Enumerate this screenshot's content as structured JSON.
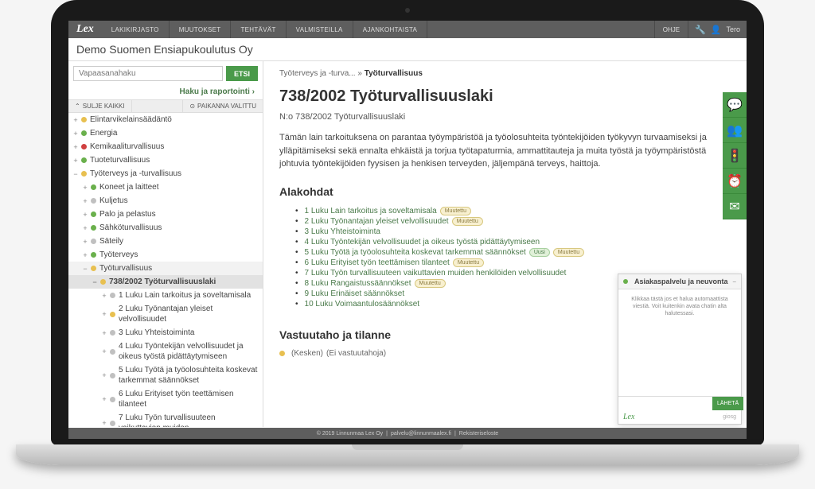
{
  "nav": {
    "logo": "Lex",
    "items": [
      "LAKIKIRJASTO",
      "MUUTOKSET",
      "TEHTÄVÄT",
      "VALMISTEILLA",
      "AJANKOHTAISTA"
    ],
    "ohje": "OHJE",
    "user": "Tero"
  },
  "company": "Demo Suomen Ensiapukoulutus Oy",
  "search": {
    "placeholder": "Vapaasanahaku",
    "button": "ETSI",
    "haku_link": "Haku ja raportointi"
  },
  "tree_ctrl": {
    "sulje": "SULJE KAIKKI",
    "paikanna": "PAIKANNA VALITTU"
  },
  "tree": {
    "elintarvike": "Elintarvikelainsäädäntö",
    "energia": "Energia",
    "kemikaali": "Kemikaaliturvallisuus",
    "tuote": "Tuoteturvallisuus",
    "tyoterveys": "Työterveys ja -turvallisuus",
    "koneet": "Koneet ja laitteet",
    "kuljetus": "Kuljetus",
    "palo": "Palo ja pelastus",
    "sahko": "Sähköturvallisuus",
    "sateily": "Säteily",
    "tyoterveys2": "Työterveys",
    "tyoturvallisuus": "Työturvallisuus",
    "law_738": "738/2002 Työturvallisuuslaki",
    "luku1": "1 Luku Lain tarkoitus ja soveltamisala",
    "luku2": "2 Luku Työnantajan yleiset velvollisuudet",
    "luku3": "3 Luku Yhteistoiminta",
    "luku4": "4 Luku Työntekijän velvollisuudet ja oikeus työstä pidättäytymiseen",
    "luku5": "5 Luku Työtä ja työolosuhteita koskevat tarkemmat säännökset",
    "luku6": "6 Luku Erityiset työn teettämisen tilanteet",
    "luku7": "7 Luku Työn turvallisuuteen vaikuttavien muiden"
  },
  "content": {
    "breadcrumb_1": "Työterveys ja -turva...",
    "breadcrumb_sep": " » ",
    "breadcrumb_2": "Työturvallisuus",
    "title": "738/2002 Työturvallisuuslaki",
    "subtitle": "N:o 738/2002 Työturvallisuuslaki",
    "body": "Tämän lain tarkoituksena on parantaa työympäristöä ja työolosuhteita työntekijöiden työkyvyn turvaamiseksi ja ylläpitämiseksi sekä ennalta ehkäistä ja torjua työtapaturmia, ammattitauteja ja muita työstä ja työympäristöstä johtuvia työntekijöiden fyysisen ja henkisen terveyden, jäljempänä terveys, haittoja.",
    "alakohdat": "Alakohdat",
    "chapters": [
      {
        "label": "1 Luku Lain tarkoitus ja soveltamisala",
        "badges": [
          "Muutettu"
        ]
      },
      {
        "label": "2 Luku Työnantajan yleiset velvollisuudet",
        "badges": [
          "Muutettu"
        ]
      },
      {
        "label": "3 Luku Yhteistoiminta",
        "badges": []
      },
      {
        "label": "4 Luku Työntekijän velvollisuudet ja oikeus työstä pidättäytymiseen",
        "badges": []
      },
      {
        "label": "5 Luku Työtä ja työolosuhteita koskevat tarkemmat säännökset",
        "badges": [
          "Uusi",
          "Muutettu"
        ]
      },
      {
        "label": "6 Luku Erityiset työn teettämisen tilanteet",
        "badges": [
          "Muutettu"
        ]
      },
      {
        "label": "7 Luku Työn turvallisuuteen vaikuttavien muiden henkilöiden velvollisuudet",
        "badges": []
      },
      {
        "label": "8 Luku Rangaistussäännökset",
        "badges": [
          "Muutettu"
        ]
      },
      {
        "label": "9 Luku Erinäiset säännökset",
        "badges": []
      },
      {
        "label": "10 Luku Voimaantulosäännökset",
        "badges": []
      }
    ],
    "vastuu_head": "Vastuutaho ja tilanne",
    "vastuu_status": "(Kesken)",
    "vastuu_note": "(Ei vastuutahoja)"
  },
  "chat": {
    "title": "Asiakaspalvelu ja neuvonta",
    "body": "Klikkaa tästä jos et halua automaattista viestiä. Voit kuitenkin avata chatin alta halutessasi.",
    "send": "LÄHETÄ",
    "logo": "Lex",
    "provider": "giosg"
  },
  "footer": {
    "copyright": "© 2019 Linnunmaa Lex Oy",
    "email": "palvelu@linnunmaalex.fi",
    "rekisteri": "Rekisteriseloste"
  }
}
